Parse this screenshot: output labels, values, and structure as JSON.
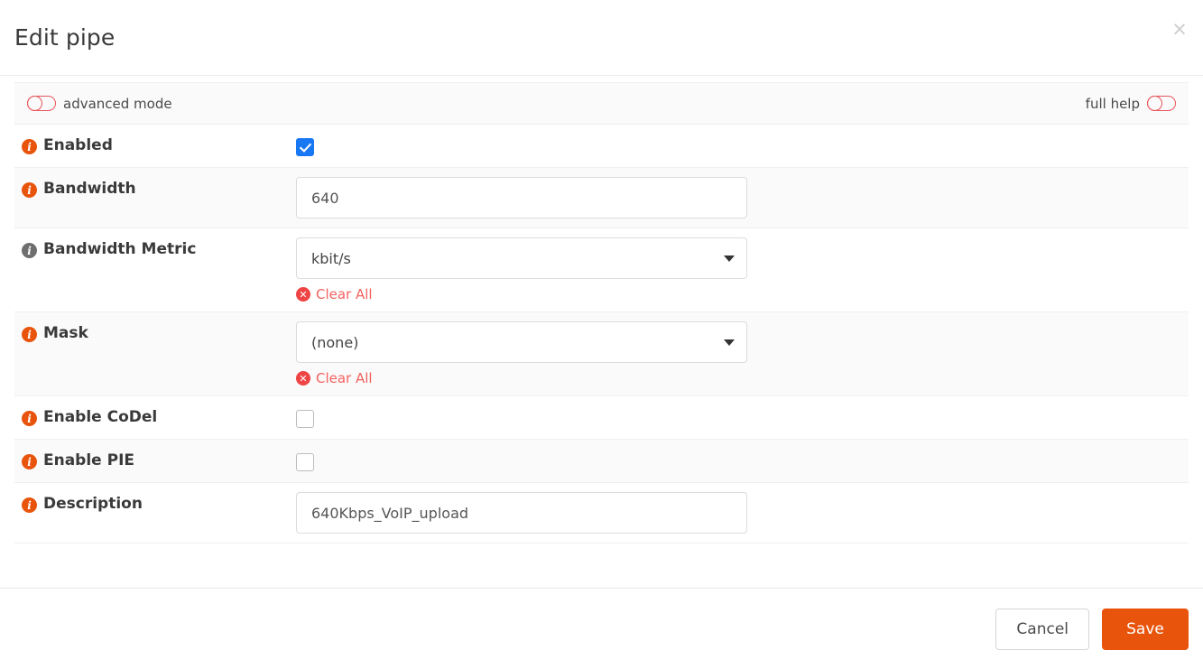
{
  "header": {
    "title": "Edit pipe",
    "close_label": "×"
  },
  "toggles": {
    "advanced_mode_label": "advanced mode",
    "advanced_mode_state": "off",
    "full_help_label": "full help",
    "full_help_state": "off"
  },
  "colors": {
    "accent_orange": "#e8540c",
    "toggle_red": "#e8545c",
    "clear_red": "#f4625f",
    "checkbox_blue": "#1878f3",
    "info_gray": "#6e6e6e"
  },
  "fields": [
    {
      "id": "enabled",
      "label": "Enabled",
      "info_icon": "info-icon",
      "info_icon_color": "orange",
      "control": "checkbox",
      "checked": true
    },
    {
      "id": "bandwidth",
      "label": "Bandwidth",
      "info_icon": "info-icon",
      "info_icon_color": "orange",
      "control": "text",
      "value": "640"
    },
    {
      "id": "bandwidth_metric",
      "label": "Bandwidth Metric",
      "info_icon": "info-icon",
      "info_icon_color": "gray",
      "control": "select",
      "value": "kbit/s",
      "clear_label": "Clear All"
    },
    {
      "id": "mask",
      "label": "Mask",
      "info_icon": "info-icon",
      "info_icon_color": "orange",
      "control": "select",
      "value": "(none)",
      "clear_label": "Clear All"
    },
    {
      "id": "enable_codel",
      "label": "Enable CoDel",
      "info_icon": "info-icon",
      "info_icon_color": "orange",
      "control": "checkbox",
      "checked": false
    },
    {
      "id": "enable_pie",
      "label": "Enable PIE",
      "info_icon": "info-icon",
      "info_icon_color": "orange",
      "control": "checkbox",
      "checked": false
    },
    {
      "id": "description",
      "label": "Description",
      "info_icon": "info-icon",
      "info_icon_color": "orange",
      "control": "text",
      "value": "640Kbps_VoIP_upload"
    }
  ],
  "footer": {
    "cancel_label": "Cancel",
    "save_label": "Save"
  }
}
